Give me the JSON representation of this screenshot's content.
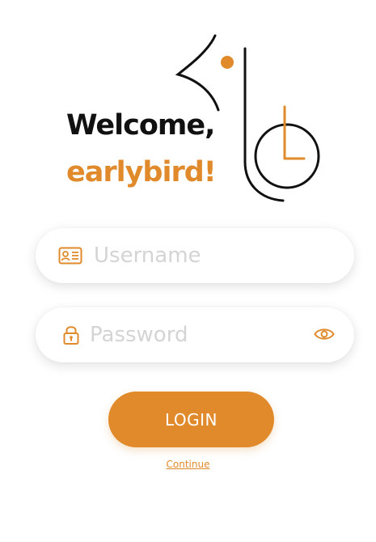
{
  "header": {
    "greeting": "Welcome,",
    "brand_name": "earlybird!"
  },
  "login_form": {
    "username": {
      "value": "",
      "placeholder": "Username",
      "icon": "id-card-icon"
    },
    "password": {
      "value": "",
      "placeholder": "Password",
      "icon": "lock-icon",
      "toggle_icon": "eye-icon"
    },
    "login_button_label": "LOGIN",
    "continue_link_label": "Continue"
  },
  "theme": {
    "accent_color": "#e08a2b",
    "text_color": "#111111",
    "placeholder_color": "#d4d4d4"
  }
}
